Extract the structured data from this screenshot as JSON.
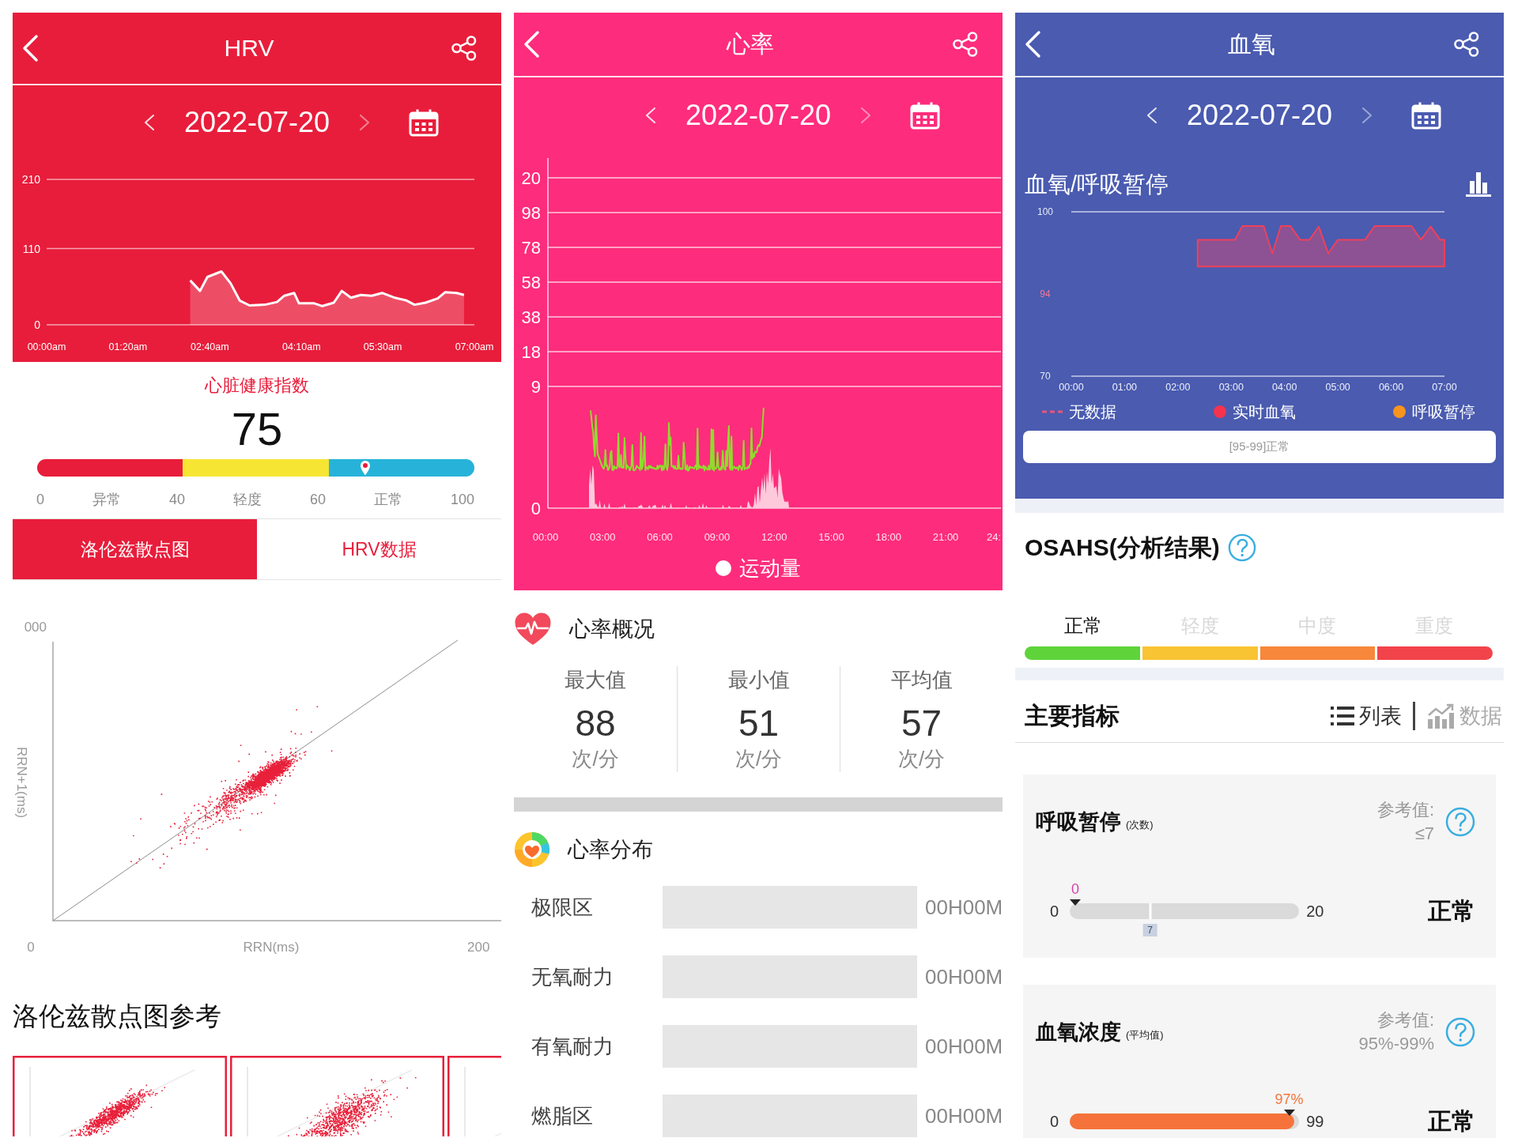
{
  "hrv_screen": {
    "header": {
      "title": "HRV"
    },
    "date_nav": {
      "date": "2022-07-20",
      "next_disabled": true
    },
    "chart_data": {
      "type": "area",
      "x": [
        2.35,
        2.51,
        2.63,
        2.86,
        3.01,
        3.16,
        3.32,
        3.57,
        3.77,
        3.89,
        4.05,
        4.13,
        4.38,
        4.51,
        4.7,
        4.83,
        4.98,
        5.14,
        5.32,
        5.49,
        5.7,
        5.89,
        6.02,
        6.2,
        6.4,
        6.52,
        6.71,
        6.83
      ],
      "values": [
        64,
        49,
        69,
        77,
        60,
        35,
        28,
        29,
        33,
        42,
        46,
        31,
        31,
        27,
        32,
        49,
        39,
        43,
        42,
        46,
        39,
        35,
        29,
        32,
        38,
        47,
        46,
        43
      ],
      "xlim": [
        0,
        7
      ],
      "ylim": [
        0,
        210
      ],
      "xticks": [
        {
          "value": 0,
          "label": "00:00am"
        },
        {
          "value": 1.33,
          "label": "01:20am"
        },
        {
          "value": 2.67,
          "label": "02:40am"
        },
        {
          "value": 4.17,
          "label": "04:10am"
        },
        {
          "value": 5.5,
          "label": "05:30am"
        },
        {
          "value": 7,
          "label": "07:00am"
        }
      ],
      "yticks": [
        210,
        110,
        0
      ]
    },
    "health_index": {
      "label": "心脏健康指数",
      "value": "75",
      "level": 0.75,
      "ticks": [
        "0",
        "40",
        "60",
        "100"
      ],
      "segments": [
        {
          "label": "异常",
          "color": "#e81d3b"
        },
        {
          "label": "轻度",
          "color": "#f6e633"
        },
        {
          "label": "正常",
          "color": "#27b3d9"
        }
      ]
    },
    "tabs": [
      {
        "label": "洛伦兹散点图",
        "selected": true
      },
      {
        "label": "HRV数据",
        "selected": false
      }
    ],
    "scatter_plot": {
      "y_axis_max": "000",
      "y_axis_title": "RRN+1(ms)",
      "x_axis_min": "0",
      "x_axis_title": "RRN(ms)",
      "x_axis_max": "200"
    },
    "reference_title": "洛伦兹散点图参考"
  },
  "heart_rate_screen": {
    "header": {
      "title": "心率"
    },
    "date_nav": {
      "date": "2022-07-20",
      "next_disabled": true
    },
    "trend_chart": {
      "y_axis_labels": [
        "20",
        "98",
        "78",
        "58",
        "38",
        "18",
        "9",
        "0"
      ],
      "x_axis_labels": [
        "00:00",
        "03:00",
        "06:00",
        "09:00",
        "12:00",
        "15:00",
        "18:00",
        "21:00",
        "24:"
      ],
      "legend_label": "运动量"
    },
    "overview": {
      "title": "心率概况",
      "stats": [
        {
          "label": "最大值",
          "value": "88",
          "unit": "次/分"
        },
        {
          "label": "最小值",
          "value": "51",
          "unit": "次/分"
        },
        {
          "label": "平均值",
          "value": "57",
          "unit": "次/分"
        }
      ]
    },
    "distribution": {
      "title": "心率分布",
      "zones": [
        {
          "label": "极限区",
          "duration": "00H00M"
        },
        {
          "label": "无氧耐力",
          "duration": "00H00M"
        },
        {
          "label": "有氧耐力",
          "duration": "00H00M"
        },
        {
          "label": "燃脂区",
          "duration": "00H00M"
        }
      ]
    }
  },
  "blood_oxygen_screen": {
    "header": {
      "title": "血氧"
    },
    "date_nav": {
      "date": "2022-07-20",
      "next_disabled": true
    },
    "chart_title": "血氧/呼吸暂停",
    "chart_data": {
      "type": "area",
      "x": [
        2.37,
        3.07,
        3.21,
        3.61,
        3.77,
        3.93,
        4.11,
        4.29,
        4.47,
        4.64,
        4.82,
        5.0,
        5.51,
        5.69,
        6.38,
        6.56,
        6.74,
        6.92,
        7.0
      ],
      "values": [
        94.9,
        94.9,
        97.4,
        97.4,
        92.4,
        97.4,
        97.4,
        94.9,
        94.9,
        97.3,
        92.4,
        94.9,
        94.9,
        97.4,
        97.4,
        94.9,
        97.3,
        94.9,
        94.9
      ],
      "xlim": [
        0,
        7
      ],
      "ylim": [
        70,
        100
      ],
      "xticks": [
        {
          "value": 0,
          "label": "00:00"
        },
        {
          "value": 1,
          "label": "01:00"
        },
        {
          "value": 2,
          "label": "02:00"
        },
        {
          "value": 3,
          "label": "03:00"
        },
        {
          "value": 4,
          "label": "04:00"
        },
        {
          "value": 5,
          "label": "05:00"
        },
        {
          "value": 6,
          "label": "06:00"
        },
        {
          "value": 7,
          "label": "07:00"
        }
      ],
      "yticks": [
        100,
        70
      ],
      "annotations": [
        "94"
      ]
    },
    "legend": [
      {
        "kind": "dashed",
        "label": "无数据",
        "color": "#e8577a"
      },
      {
        "kind": "dot",
        "label": "实时血氧",
        "color": "#f5334f"
      },
      {
        "kind": "dot",
        "label": "呼吸暂停",
        "color": "#f7941d"
      }
    ],
    "range_note": "[95-99]正常",
    "osahs": {
      "title": "OSAHS(分析结果)",
      "levels": [
        {
          "label": "正常",
          "selected": true,
          "color": "#5ed43a"
        },
        {
          "label": "轻度",
          "selected": false,
          "color": "#f9c433"
        },
        {
          "label": "中度",
          "selected": false,
          "color": "#f7873a"
        },
        {
          "label": "重度",
          "selected": false,
          "color": "#f2434b"
        }
      ]
    },
    "main_indicators": {
      "title": "主要指标",
      "views": [
        {
          "kind": "list",
          "label": "列表",
          "selected": true
        },
        {
          "kind": "chart",
          "label": "数据",
          "selected": false
        }
      ],
      "cards": [
        {
          "title": "呼吸暂停",
          "unit": "(次数)",
          "reference_label": "参考值:",
          "reference_value": "≤7",
          "marker_label": "0",
          "color": "#d63fa9",
          "level": 0,
          "min_label": "0",
          "max_label": "20",
          "threshold_label": "7",
          "verdict": "正常"
        },
        {
          "title": "血氧浓度",
          "unit": "(平均值)",
          "reference_label": "参考值:",
          "reference_value": "95%-99%",
          "marker_label": "97%",
          "color": "#f5733b",
          "level": 0.98,
          "min_label": "0",
          "max_label": "99",
          "verdict": "正常"
        }
      ]
    }
  }
}
